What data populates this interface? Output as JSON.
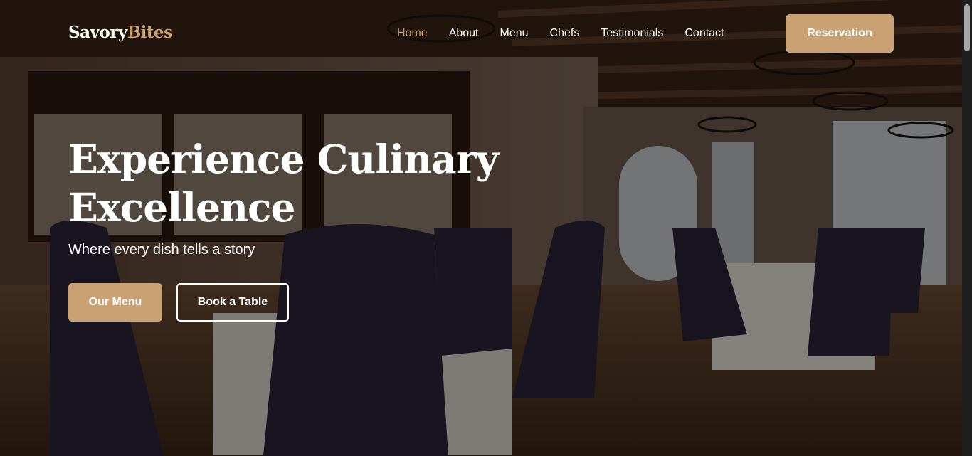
{
  "logo": {
    "part1": "Savory",
    "part2": "Bites"
  },
  "nav": {
    "items": [
      "Home",
      "About",
      "Menu",
      "Chefs",
      "Testimonials",
      "Contact"
    ],
    "active": "Home",
    "reservation": "Reservation"
  },
  "hero": {
    "title": "Experience Culinary Excellence",
    "subtitle": "Where every dish tells a story",
    "menu_button": "Our Menu",
    "book_button": "Book a Table"
  },
  "colors": {
    "accent": "#c9a172",
    "text": "#ffffff"
  }
}
